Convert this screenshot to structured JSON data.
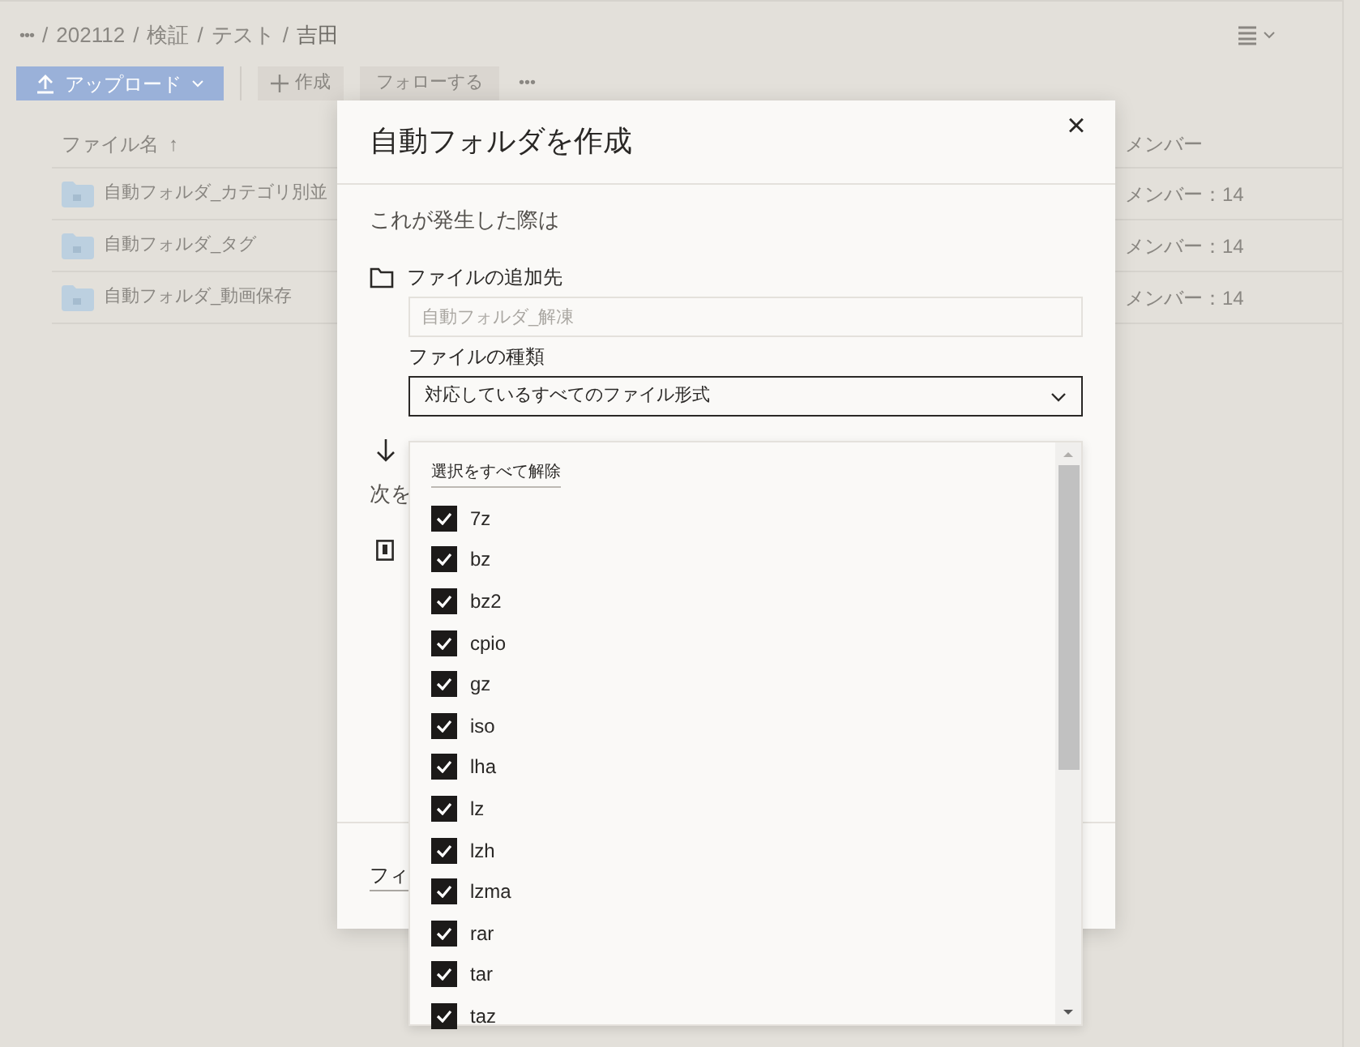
{
  "breadcrumb": {
    "more": "•••",
    "items": [
      "202112",
      "検証",
      "テスト",
      "吉田"
    ],
    "separator": "/"
  },
  "toolbar": {
    "upload": "アップロード",
    "create": "作成",
    "follow": "フォローする",
    "more": "•••"
  },
  "table": {
    "columns": [
      "ファイル名",
      "メンバー"
    ],
    "sort_arrow": "↑",
    "rows": [
      {
        "name": "自動フォルダ_カテゴリ別並",
        "members": "メンバー：14"
      },
      {
        "name": "自動フォルダ_タグ",
        "members": "メンバー：14"
      },
      {
        "name": "自動フォルダ_動画保存",
        "members": "メンバー：14"
      }
    ]
  },
  "dialog": {
    "title": "自動フォルダを作成",
    "close": "×",
    "trigger_heading": "これが発生した際は",
    "destination_label": "ファイルの追加先",
    "destination_placeholder": "自動フォルダ_解凍",
    "type_label": "ファイルの種類",
    "type_value": "対応しているすべてのファイル形式",
    "action_heading": "次を",
    "footer_link": "フィ"
  },
  "dropdown": {
    "deselect_all": "選択をすべて解除",
    "options": [
      {
        "label": "7z",
        "checked": true
      },
      {
        "label": "bz",
        "checked": true
      },
      {
        "label": "bz2",
        "checked": true
      },
      {
        "label": "cpio",
        "checked": true
      },
      {
        "label": "gz",
        "checked": true
      },
      {
        "label": "iso",
        "checked": true
      },
      {
        "label": "lha",
        "checked": true
      },
      {
        "label": "lz",
        "checked": true
      },
      {
        "label": "lzh",
        "checked": true
      },
      {
        "label": "lzma",
        "checked": true
      },
      {
        "label": "rar",
        "checked": true
      },
      {
        "label": "tar",
        "checked": true
      },
      {
        "label": "taz",
        "checked": true
      }
    ]
  }
}
